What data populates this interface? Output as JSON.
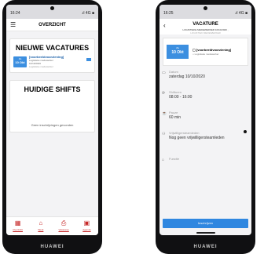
{
  "left_phone": {
    "status_time": "16:24",
    "status_right": ".ıl 4G ■",
    "title": "OVERZICHT",
    "menu_icon": "☰",
    "section1_title": "NIEUWE VACATURES",
    "vacancy": {
      "day": "Za",
      "date": "10 Okt",
      "name": "[voorbeeldvoorziening]",
      "role": "Logistieke medewerker",
      "date_line": "10/10/2020",
      "location": "Logistieke medewerker"
    },
    "section2_title": "HUIDIGE SHIFTS",
    "empty_text": "Geen inschrijvingen gevonden",
    "nav": [
      {
        "icon": "▦",
        "label": "Overzicht"
      },
      {
        "icon": "⌂",
        "label": "Werk"
      },
      {
        "icon": "⎙",
        "label": "Vacatures"
      },
      {
        "icon": "▣",
        "label": "Agenda"
      }
    ],
    "brand": "HUAWEI"
  },
  "right_phone": {
    "status_time": "16:25",
    "status_right": ".ıl 4G ■",
    "title": "VACATURE",
    "subtitle1": "LOGISTIEKE MEDEWERKER 10/10/2020 ,",
    "subtitle2": "LOGISTIEK MEDEWERKER",
    "back_icon": "‹",
    "vacancy": {
      "day": "Za",
      "date": "10 Okt",
      "name": "[voorbeeldvoorziening]",
      "role": "Logistieke medewerker"
    },
    "fields": [
      {
        "icon": "▭",
        "label": "Datum",
        "value": "zaterdag 10/10/2020"
      },
      {
        "icon": "⟳",
        "label": "Shifturen",
        "value": "08:00 - 16:00"
      },
      {
        "icon": "☕",
        "label": "Pauze",
        "value": "60 min"
      },
      {
        "icon": "⚇",
        "label": "Vrijwilligersteamleden",
        "value": "Nog geen vrijwilligersteamleden"
      },
      {
        "icon": "⌂",
        "label": "Functie",
        "value": ""
      }
    ],
    "button": "Inschrijven",
    "brand": "HUAWEI"
  }
}
